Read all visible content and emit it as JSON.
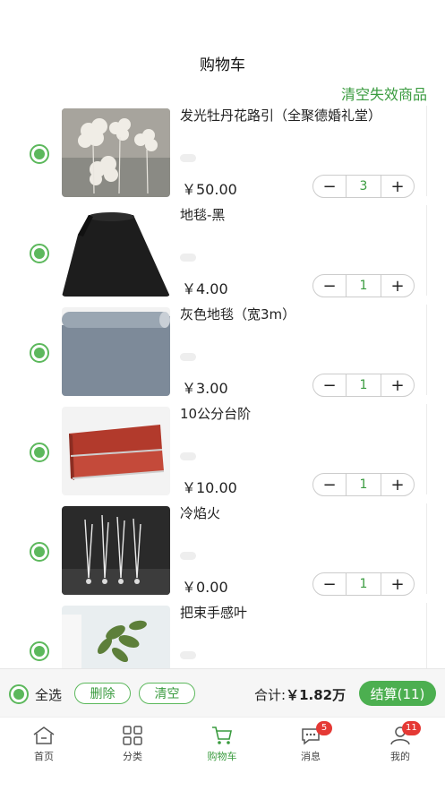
{
  "header": {
    "title": "购物车",
    "clear_invalid": "清空失效商品"
  },
  "items": [
    {
      "name": "发光牡丹花路引（全聚德婚礼堂）",
      "price": "￥50.00",
      "qty": "3",
      "image": "glowing-peony-flowers"
    },
    {
      "name": "地毯-黑",
      "price": "￥4.00",
      "qty": "1",
      "image": "black-carpet-roll"
    },
    {
      "name": "灰色地毯（宽3m）",
      "price": "￥3.00",
      "qty": "1",
      "image": "gray-carpet-roll"
    },
    {
      "name": "10公分台阶",
      "price": "￥10.00",
      "qty": "1",
      "image": "red-stage-steps"
    },
    {
      "name": "冷焰火",
      "price": "￥0.00",
      "qty": "1",
      "image": "cold-fireworks"
    },
    {
      "name": "把束手感叶",
      "price": "",
      "qty": "",
      "image": "green-leaf-plant"
    }
  ],
  "stepper": {
    "minus": "−",
    "plus": "+"
  },
  "bottom_bar": {
    "select_all": "全选",
    "delete": "删除",
    "clear": "清空",
    "total_label": "合计:",
    "total_value": "￥1.82万",
    "checkout": "结算(11)"
  },
  "tabbar": [
    {
      "label": "首页",
      "icon": "home-icon",
      "badge": ""
    },
    {
      "label": "分类",
      "icon": "category-icon",
      "badge": ""
    },
    {
      "label": "购物车",
      "icon": "cart-icon",
      "badge": ""
    },
    {
      "label": "消息",
      "icon": "message-icon",
      "badge": "5"
    },
    {
      "label": "我的",
      "icon": "profile-icon",
      "badge": "11"
    }
  ],
  "colors": {
    "accent": "#4caf50",
    "accent_text": "#3a9b3f",
    "badge": "#e53935"
  }
}
